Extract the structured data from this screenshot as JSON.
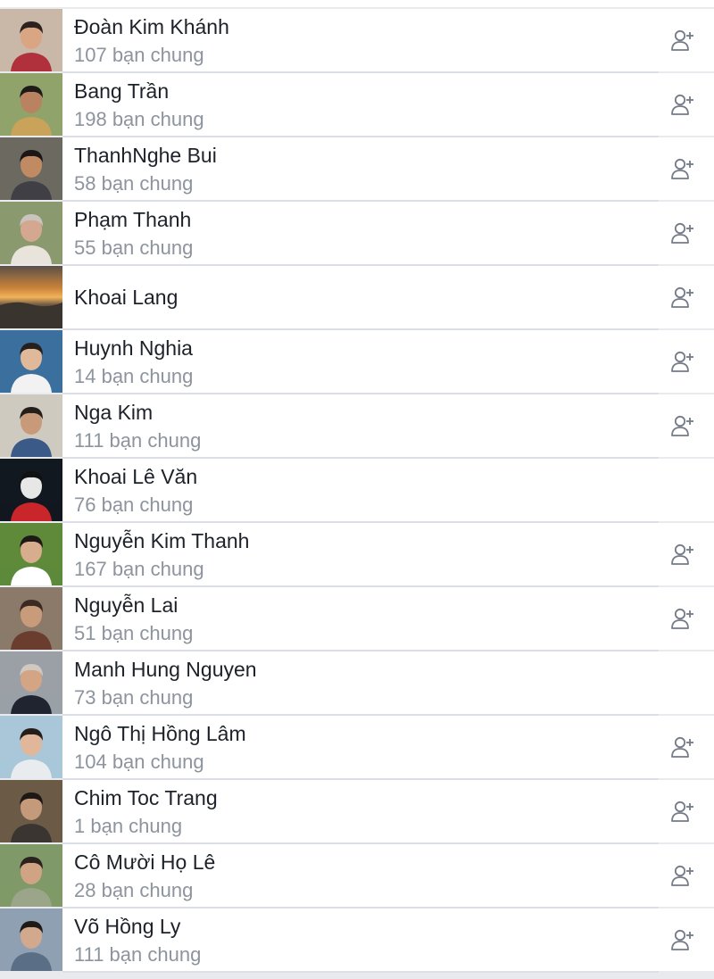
{
  "colors": {
    "name": "#1d2129",
    "secondary": "#8d949e",
    "icon": "#737b87",
    "background": "#e9eaed",
    "row": "#ffffff"
  },
  "friend_suggestions": [
    {
      "name": "Đoàn Kim Khánh",
      "mutual": "107 bạn chung",
      "has_add_button": true,
      "avatar_icon": "profile-photo"
    },
    {
      "name": "Bang Trần",
      "mutual": "198 bạn chung",
      "has_add_button": true,
      "avatar_icon": "profile-photo"
    },
    {
      "name": "ThanhNghe Bui",
      "mutual": "58 bạn chung",
      "has_add_button": true,
      "avatar_icon": "profile-photo"
    },
    {
      "name": "Phạm Thanh",
      "mutual": "55 bạn chung",
      "has_add_button": true,
      "avatar_icon": "profile-photo"
    },
    {
      "name": "Khoai Lang",
      "mutual": "",
      "has_add_button": true,
      "avatar_icon": "sunset-photo"
    },
    {
      "name": "Huynh Nghia",
      "mutual": "14 bạn chung",
      "has_add_button": true,
      "avatar_icon": "profile-photo"
    },
    {
      "name": "Nga Kim",
      "mutual": "111 bạn chung",
      "has_add_button": true,
      "avatar_icon": "profile-photo"
    },
    {
      "name": "Khoai Lê Văn",
      "mutual": "76 bạn chung",
      "has_add_button": false,
      "avatar_icon": "profile-photo"
    },
    {
      "name": "Nguyễn Kim Thanh",
      "mutual": "167 bạn chung",
      "has_add_button": true,
      "avatar_icon": "profile-photo"
    },
    {
      "name": "Nguyễn Lai",
      "mutual": "51 bạn chung",
      "has_add_button": true,
      "avatar_icon": "profile-photo"
    },
    {
      "name": "Manh Hung Nguyen",
      "mutual": "73 bạn chung",
      "has_add_button": false,
      "avatar_icon": "profile-photo"
    },
    {
      "name": "Ngô Thị Hồng Lâm",
      "mutual": "104 bạn chung",
      "has_add_button": true,
      "avatar_icon": "profile-photo"
    },
    {
      "name": "Chim Toc Trang",
      "mutual": "1 bạn chung",
      "has_add_button": true,
      "avatar_icon": "profile-photo"
    },
    {
      "name": "Cô Mười Họ Lê",
      "mutual": "28 bạn chung",
      "has_add_button": true,
      "avatar_icon": "profile-photo"
    },
    {
      "name": "Võ Hồng Ly",
      "mutual": "111 bạn chung",
      "has_add_button": true,
      "avatar_icon": "profile-photo"
    }
  ]
}
